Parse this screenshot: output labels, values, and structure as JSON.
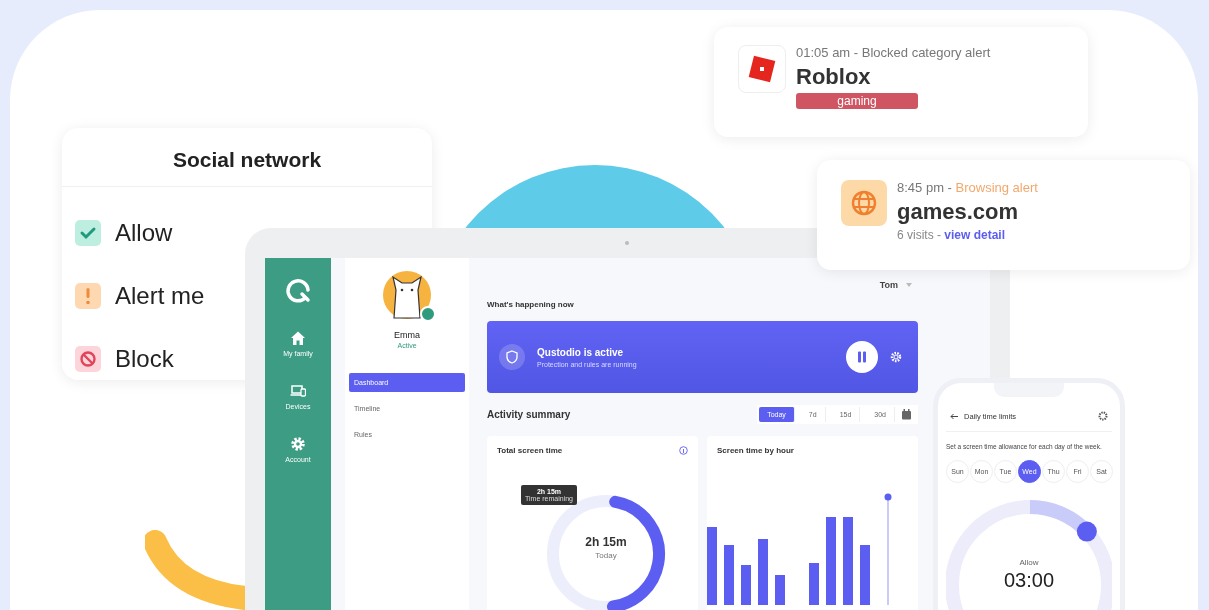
{
  "social_card": {
    "title": "Social network",
    "options": [
      {
        "kind": "allow",
        "label": "Allow"
      },
      {
        "kind": "alert",
        "label": "Alert me"
      },
      {
        "kind": "block",
        "label": "Block"
      }
    ]
  },
  "alerts": [
    {
      "kind": "app",
      "time": "01:05 am - ",
      "category": "Blocked category alert",
      "title": "Roblox",
      "tag": "gaming"
    },
    {
      "kind": "browsing",
      "time": "8:45 pm - ",
      "category": "Browsing alert",
      "title": "games.com",
      "visits": "6 visits - ",
      "link": "view detail"
    }
  ],
  "tablet": {
    "nav": [
      {
        "kind": "home",
        "label": "My family"
      },
      {
        "kind": "devices",
        "label": "Devices"
      },
      {
        "kind": "account",
        "label": "Account"
      }
    ],
    "profile": {
      "name": "Emma",
      "status": "Active",
      "menu": [
        {
          "label": "Dashboard",
          "selected": true
        },
        {
          "label": "Timeline",
          "selected": false
        },
        {
          "label": "Rules",
          "selected": false
        }
      ]
    },
    "user_menu": "Tom",
    "section_title": "What's happening now",
    "banner": {
      "title": "Qustodio is active",
      "subtitle": "Protection and rules are running"
    },
    "activity_title": "Activity summary",
    "periods": [
      {
        "label": "Today",
        "selected": true
      },
      {
        "label": "7d",
        "selected": false
      },
      {
        "label": "15d",
        "selected": false
      },
      {
        "label": "30d",
        "selected": false
      }
    ],
    "total_card": {
      "title": "Total screen time",
      "tooltip_value": "2h 15m",
      "tooltip_label": "Time remaining",
      "value": "2h 15m",
      "label": "Today"
    },
    "hour_card": {
      "title": "Screen time by hour"
    }
  },
  "phone": {
    "title": "Daily time limits",
    "description": "Set a screen time allowance for each day of the week.",
    "days": [
      {
        "label": "Sun",
        "selected": false
      },
      {
        "label": "Mon",
        "selected": false
      },
      {
        "label": "Tue",
        "selected": false
      },
      {
        "label": "Wed",
        "selected": true
      },
      {
        "label": "Thu",
        "selected": false
      },
      {
        "label": "Fri",
        "selected": false
      },
      {
        "label": "Sat",
        "selected": false
      }
    ],
    "dial": {
      "label": "Allow",
      "value": "03:00"
    }
  }
}
